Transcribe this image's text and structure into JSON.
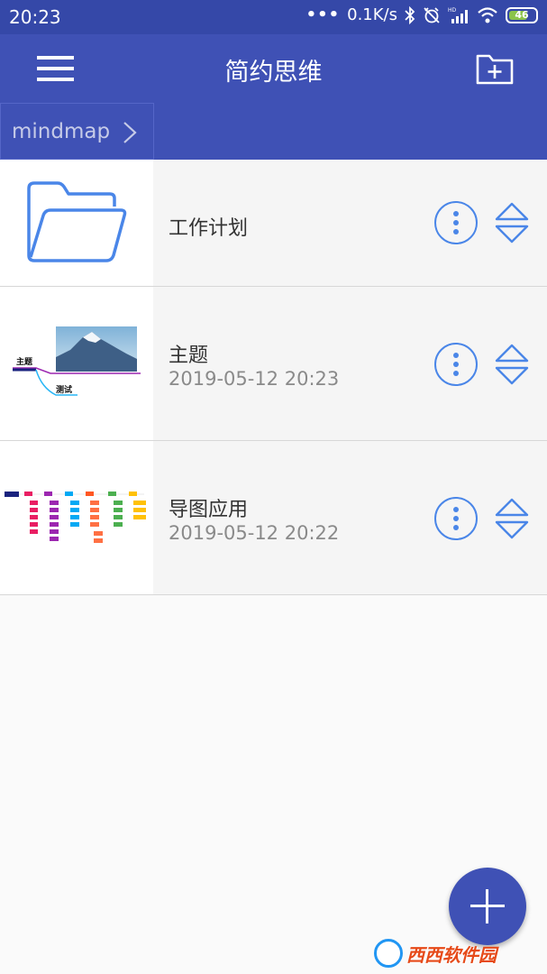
{
  "statusbar": {
    "time": "20:23",
    "dots": "•••",
    "speed": "0.1K/s",
    "battery": "46",
    "icons": [
      "bluetooth-icon",
      "alarm-off-icon",
      "hd-signal-icon",
      "wifi-icon",
      "battery-icon"
    ]
  },
  "appbar": {
    "title": "简约思维",
    "menu_icon": "hamburger-menu-icon",
    "action_icon": "new-folder-icon"
  },
  "breadcrumb": {
    "label": "mindmap"
  },
  "items": [
    {
      "name": "工作计划",
      "date": "",
      "type": "folder"
    },
    {
      "name": "主题",
      "date": "2019-05-12 20:23",
      "type": "mindmap",
      "thumb_labels": [
        "主题",
        "测试"
      ]
    },
    {
      "name": "导图应用",
      "date": "2019-05-12 20:22",
      "type": "mindmap"
    }
  ],
  "fab": {
    "icon": "add-icon"
  },
  "watermark": {
    "text": "西西软件园"
  },
  "colors": {
    "primary": "#3f51b5",
    "statusbar": "#3548a8",
    "accent_icon": "#4a86e8"
  }
}
